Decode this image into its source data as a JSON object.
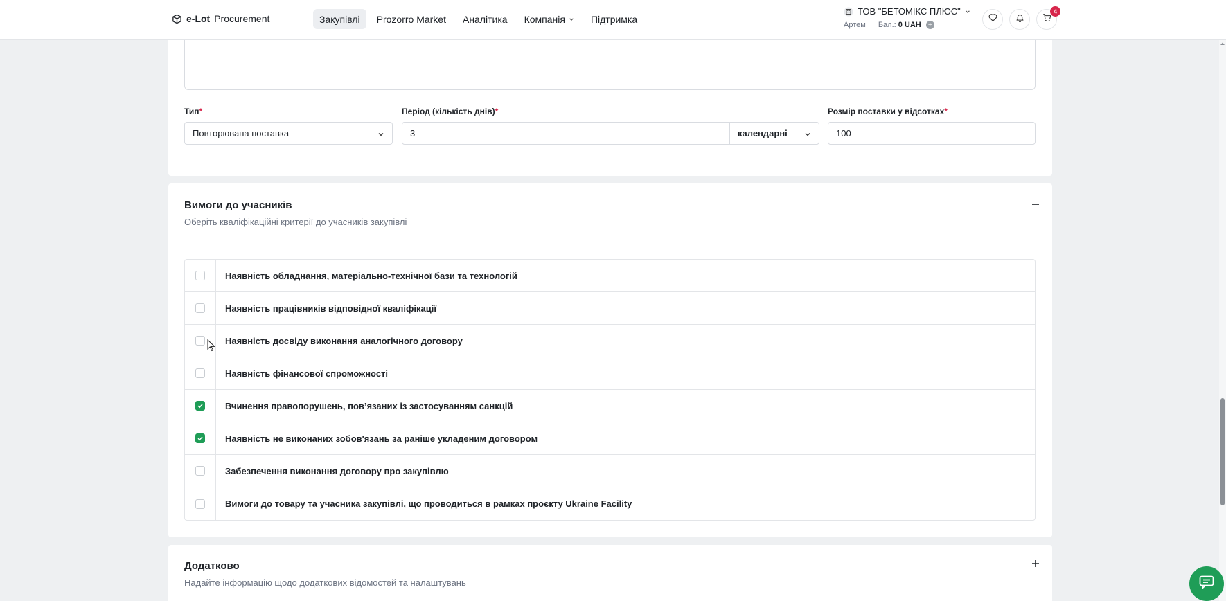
{
  "header": {
    "logo_bold": "e-Lot",
    "logo_light": "Procurement",
    "nav": [
      {
        "label": "Закупівлі",
        "active": true
      },
      {
        "label": "Prozorro Market",
        "active": false
      },
      {
        "label": "Аналітика",
        "active": false
      },
      {
        "label": "Компанія",
        "active": false,
        "dropdown": true
      },
      {
        "label": "Підтримка",
        "active": false
      }
    ],
    "company_name": "ТОВ \"БЕТОМІКС ПЛЮС\"",
    "user_name": "Артем",
    "balance_label": "Бал.:",
    "balance_value": "0 UAH",
    "cart_badge": "4"
  },
  "delivery": {
    "type_label": "Тип",
    "type_value": "Повторювана поставка",
    "period_label": "Період (кількість днів)",
    "period_value": "3",
    "period_unit": "календарні",
    "size_label": "Розмір поставки у відсотках",
    "size_value": "100",
    "required_mark": "*"
  },
  "requirements": {
    "title": "Вимоги до учасників",
    "subtitle": "Оберіть кваліфікаційні критерії до учасників закупівлі",
    "items": [
      {
        "label": "Наявність обладнання, матеріально-технічної бази та технологій",
        "checked": false
      },
      {
        "label": "Наявність працівників відповідної кваліфікації",
        "checked": false
      },
      {
        "label": "Наявність досвіду виконання аналогічного договору",
        "checked": false
      },
      {
        "label": "Наявність фінансової спроможності",
        "checked": false
      },
      {
        "label": "Вчинення правопорушень, пов’язаних із застосуванням санкцій",
        "checked": true
      },
      {
        "label": "Наявність не виконаних зобов'язань за раніше укладеним договором",
        "checked": true
      },
      {
        "label": "Забезпечення виконання договору про закупівлю",
        "checked": false
      },
      {
        "label": "Вимоги до товару та учасника закупівлі, що проводиться в рамках проєкту Ukraine Facility",
        "checked": false
      }
    ]
  },
  "extra": {
    "title": "Додатково",
    "subtitle": "Надайте інформацію щодо додаткових відомостей та налаштувань"
  },
  "colors": {
    "accent_green": "#1f9d57",
    "badge_red": "#d7264b",
    "page_bg": "#eef0f2"
  },
  "icons": {
    "logo": "cube-icon",
    "company": "building-icon",
    "favorites": "heart-icon",
    "notifications": "bell-icon",
    "cart": "cart-icon",
    "collapse": "minus-icon",
    "expand": "plus-icon",
    "chat": "chat-icon"
  }
}
